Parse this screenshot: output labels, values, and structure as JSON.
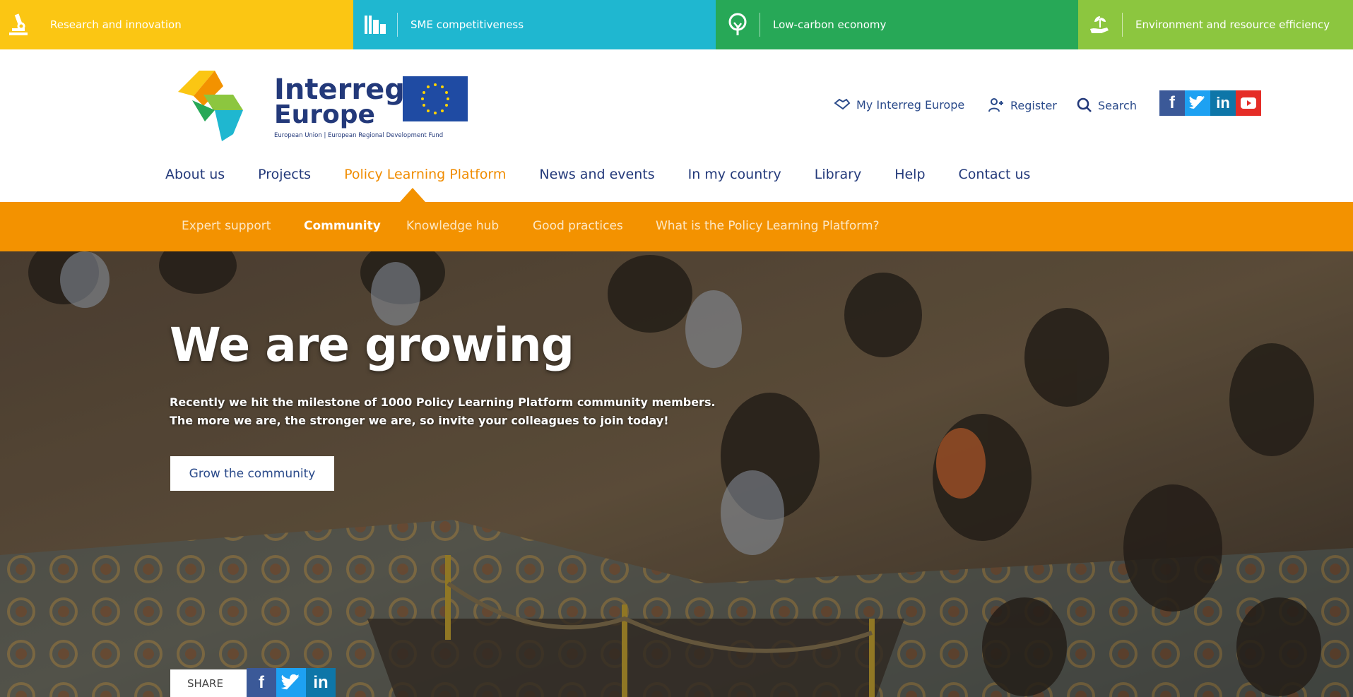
{
  "topics": [
    {
      "label": "Research and innovation",
      "color": "#fbc613",
      "icon": "microscope-icon"
    },
    {
      "label": "SME competitiveness",
      "color": "#1fb7d0",
      "icon": "buildings-icon"
    },
    {
      "label": "Low-carbon economy",
      "color": "#27a857",
      "icon": "tree-icon"
    },
    {
      "label": "Environment and resource efficiency",
      "color": "#8cc63f",
      "icon": "hand-plant-icon"
    }
  ],
  "logo": {
    "word1": "Interreg",
    "word2": "Europe",
    "tagline": "European Union | European Regional Development Fund"
  },
  "utility": {
    "my_interreg": "My Interreg Europe",
    "register": "Register",
    "search": "Search"
  },
  "social_top": {
    "facebook": "f",
    "twitter": "t",
    "linkedin": "in",
    "youtube": "▶"
  },
  "main_nav": [
    {
      "label": "About us"
    },
    {
      "label": "Projects"
    },
    {
      "label": "Policy Learning Platform",
      "active": true
    },
    {
      "label": "News and events"
    },
    {
      "label": "In my country"
    },
    {
      "label": "Library"
    },
    {
      "label": "Help"
    },
    {
      "label": "Contact us"
    }
  ],
  "sub_nav": [
    {
      "label": "Expert support"
    },
    {
      "label": "Community",
      "active": true
    },
    {
      "label": "Knowledge hub"
    },
    {
      "label": "Good practices"
    },
    {
      "label": "What is the Policy Learning Platform?"
    }
  ],
  "hero": {
    "title": "We are growing",
    "line1": "Recently we hit the milestone of 1000 Policy Learning Platform community members.",
    "line2": "The more we are, the stronger we are, so invite your colleagues to join today!",
    "button": "Grow the community",
    "share_label": "SHARE"
  },
  "colors": {
    "accent_orange": "#f39200",
    "navy": "#23397a",
    "facebook": "#3b5998",
    "twitter": "#1da1f2",
    "linkedin": "#0e76a8",
    "youtube": "#e52d27"
  }
}
